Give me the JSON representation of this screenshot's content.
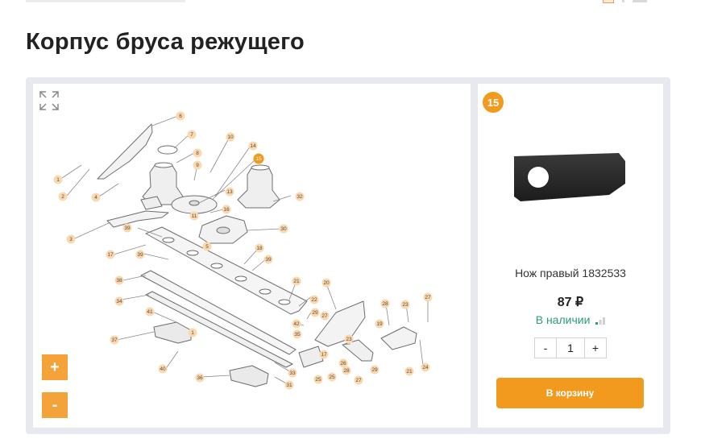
{
  "page": {
    "title": "Корпус бруса режущего"
  },
  "diagram": {
    "callouts": [
      "1",
      "2",
      "3",
      "4",
      "6",
      "7",
      "8",
      "9",
      "10",
      "11",
      "13",
      "14",
      "15",
      "16",
      "5",
      "30",
      "32",
      "39",
      "17",
      "39",
      "18",
      "39",
      "38",
      "34",
      "21",
      "20",
      "22",
      "29",
      "27",
      "42",
      "35",
      "41",
      "37",
      "1",
      "40",
      "36",
      "33",
      "31",
      "25",
      "25",
      "17",
      "23",
      "26",
      "28",
      "27",
      "29",
      "28",
      "19",
      "23",
      "27",
      "21",
      "24"
    ]
  },
  "controls": {
    "zoom_in": "+",
    "zoom_out": "-"
  },
  "product": {
    "callout_number": "15",
    "name": "Нож правый 1832533",
    "price": "87 ₽",
    "stock": "В наличии",
    "quantity": "1",
    "minus": "-",
    "plus": "+",
    "cart_button": "В корзину"
  },
  "colors": {
    "accent": "#f19a1e",
    "callout_bg": "#fad9b0",
    "stock": "#2a9d73",
    "frame": "#e7e9ee"
  }
}
